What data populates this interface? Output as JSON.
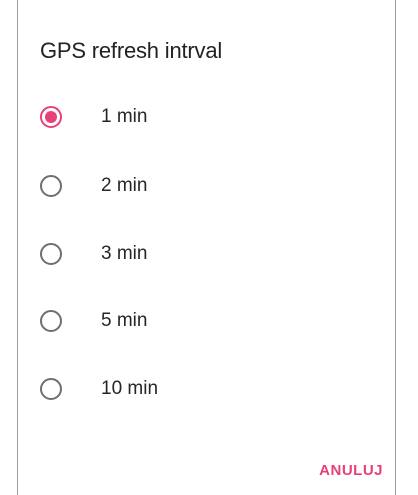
{
  "dialog": {
    "title": "GPS refresh intrval",
    "options": [
      {
        "label": "1 min",
        "selected": true
      },
      {
        "label": "2 min",
        "selected": false
      },
      {
        "label": "3 min",
        "selected": false
      },
      {
        "label": "5 min",
        "selected": false
      },
      {
        "label": "10 min",
        "selected": false
      }
    ],
    "cancel_label": "ANULUJ"
  },
  "colors": {
    "accent": "#e8407a",
    "radio_unchecked": "#6f6f6f",
    "text": "#262626"
  }
}
